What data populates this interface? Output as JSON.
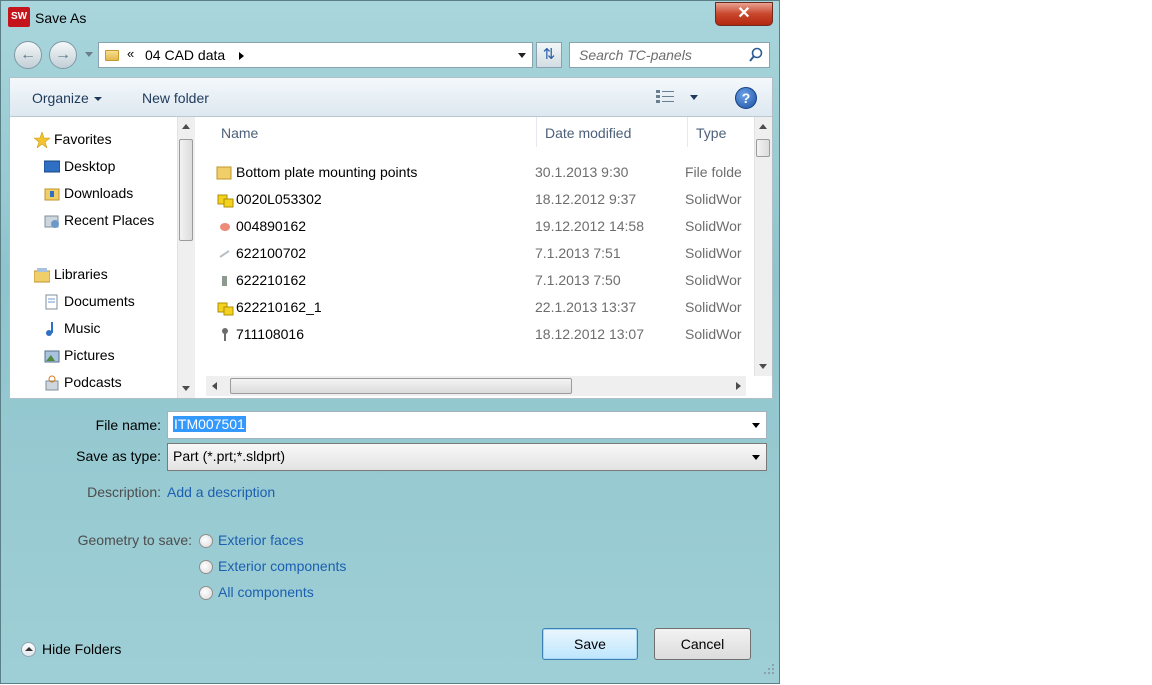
{
  "window": {
    "title": "Save As",
    "app_icon": "SW",
    "close_glyph": "✕"
  },
  "nav": {
    "back_icon": "back-arrow-icon",
    "forward_icon": "forward-arrow-icon",
    "breadcrumb_chevron": "«",
    "breadcrumb_segment": "04 CAD data",
    "search_placeholder": "Search TC-panels"
  },
  "toolbar": {
    "organize_label": "Organize",
    "new_folder_label": "New folder",
    "help_glyph": "?"
  },
  "sidebar": {
    "items": [
      {
        "label": "Favorites",
        "icon": "star-icon",
        "group": true
      },
      {
        "label": "Desktop",
        "icon": "desktop-icon"
      },
      {
        "label": "Downloads",
        "icon": "downloads-folder-icon"
      },
      {
        "label": "Recent Places",
        "icon": "recent-places-icon"
      },
      {
        "label": "Libraries",
        "icon": "libraries-icon",
        "group": true
      },
      {
        "label": "Documents",
        "icon": "documents-icon"
      },
      {
        "label": "Music",
        "icon": "music-icon"
      },
      {
        "label": "Pictures",
        "icon": "pictures-icon"
      },
      {
        "label": "Podcasts",
        "icon": "podcasts-icon"
      }
    ]
  },
  "file_list": {
    "columns": [
      "Name",
      "Date modified",
      "Type"
    ],
    "rows": [
      {
        "name": "Bottom plate mounting points",
        "date": "30.1.2013 9:30",
        "type": "File folder",
        "icon": "folder-icon"
      },
      {
        "name": "0020L053302",
        "date": "18.12.2012 9:37",
        "type": "SolidWorks",
        "icon": "assembly-icon"
      },
      {
        "name": "004890162",
        "date": "19.12.2012 14:58",
        "type": "SolidWorks",
        "icon": "part-icon"
      },
      {
        "name": "622100702",
        "date": "7.1.2013 7:51",
        "type": "SolidWorks",
        "icon": "part-icon"
      },
      {
        "name": "622210162",
        "date": "7.1.2013 7:50",
        "type": "SolidWorks",
        "icon": "part-icon"
      },
      {
        "name": "622210162_1",
        "date": "22.1.2013 13:37",
        "type": "SolidWorks",
        "icon": "assembly-icon"
      },
      {
        "name": "711108016",
        "date": "18.12.2012 13:07",
        "type": "SolidWorks",
        "icon": "part-icon"
      }
    ]
  },
  "form": {
    "file_name_label": "File name:",
    "file_name_value": "ITM007501",
    "save_as_type_label": "Save as type:",
    "save_as_type_value": "Part (*.prt;*.sldprt)",
    "description_label": "Description:",
    "description_link": "Add a description",
    "geometry_label": "Geometry to save:",
    "geometry_options": [
      "Exterior faces",
      "Exterior components",
      "All components"
    ]
  },
  "footer": {
    "hide_folders_label": "Hide Folders",
    "save_label": "Save",
    "cancel_label": "Cancel"
  },
  "colors": {
    "title_chrome": "#a9d6dc",
    "close_button": "#c9462c",
    "link": "#1c5fb0",
    "selection": "#3399ff"
  }
}
